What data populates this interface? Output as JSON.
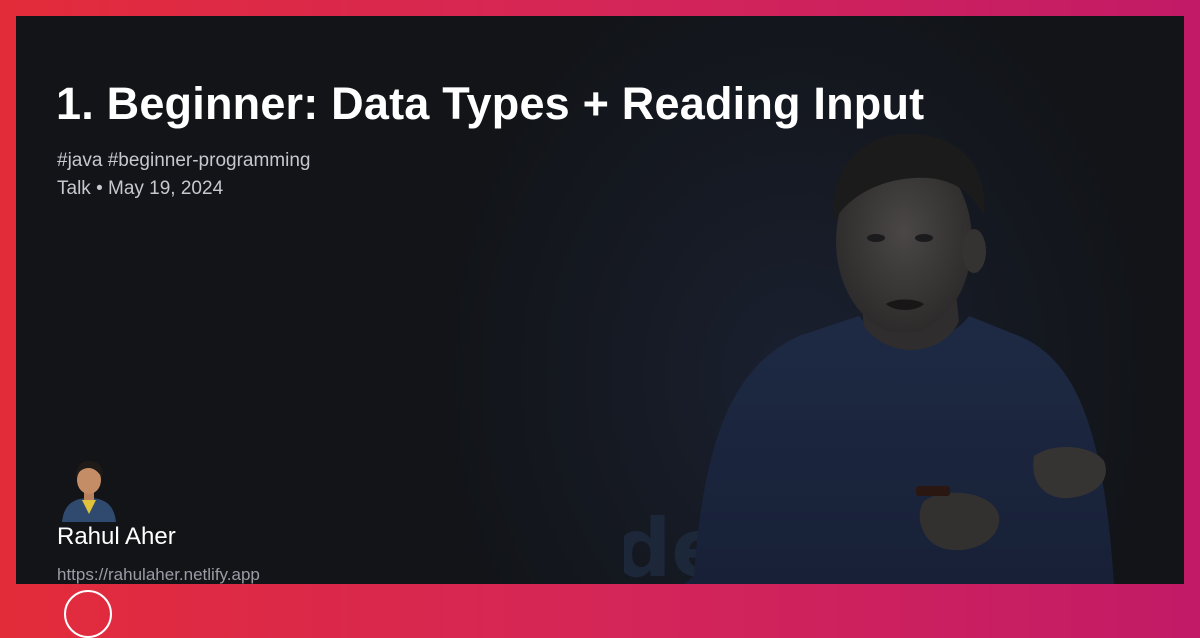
{
  "post": {
    "title": "1. Beginner: Data Types + Reading Input",
    "tags": "#java #beginner-programming",
    "meta": "Talk • May 19, 2024"
  },
  "author": {
    "name": "Rahul Aher",
    "url": "https://rahulaher.netlify.app"
  },
  "colors": {
    "frame_gradient_start": "#e32c3a",
    "frame_gradient_end": "#c21a66",
    "card_background": "#15181f",
    "title_text": "#ffffff",
    "meta_text": "#c6c8cf",
    "url_text": "#9a9ca6"
  },
  "icons": {
    "avatar": "author-avatar-icon",
    "logo": "site-logo-icon"
  }
}
